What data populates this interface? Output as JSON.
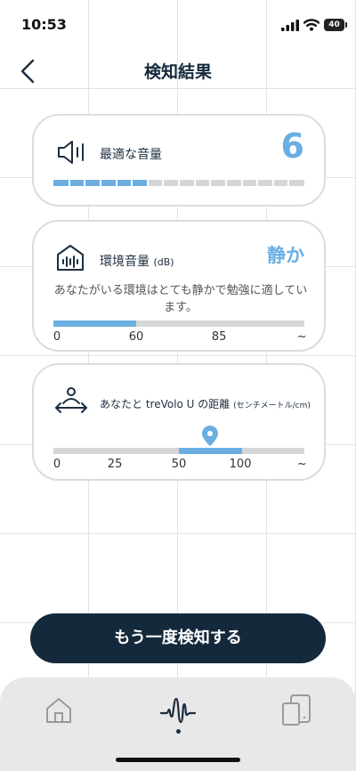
{
  "status_bar": {
    "time": "10:53",
    "battery": "40",
    "icons": [
      "signal-icon",
      "wifi-icon",
      "battery-icon"
    ]
  },
  "header": {
    "title": "検知結果",
    "back_icon": "chevron-left-icon"
  },
  "optimal_volume": {
    "icon": "speaker-icon",
    "label": "最適な音量",
    "value": "6",
    "level_fraction": 0.375,
    "max_steps": 16
  },
  "ambient_volume": {
    "icon": "house-soundwave-icon",
    "label": "環境音量",
    "unit": "(dB)",
    "status": "静か",
    "description": "あなたがいる環境はとても静かで勉強に適しています。",
    "scale": [
      "0",
      "60",
      "85",
      "~"
    ],
    "fill_fraction": 0.33
  },
  "distance": {
    "icon": "person-distance-icon",
    "label": "あなたと treVolo U の距離",
    "unit": "(センチメートル/cm)",
    "scale": [
      "0",
      "25",
      "50",
      "100",
      "~"
    ],
    "range_start_fraction": 0.5,
    "range_end_fraction": 0.75,
    "marker_fraction": 0.625,
    "marker_icon": "location-pin-icon"
  },
  "actions": {
    "retry_label": "もう一度検知する"
  },
  "tab_bar": {
    "items": [
      {
        "icon": "home-icon",
        "active": false
      },
      {
        "icon": "soundwave-icon",
        "active": true
      },
      {
        "icon": "device-icon",
        "active": false
      }
    ]
  },
  "colors": {
    "accent": "#6aaee2",
    "primary_dark": "#14293b",
    "track": "#d6d6d6"
  }
}
